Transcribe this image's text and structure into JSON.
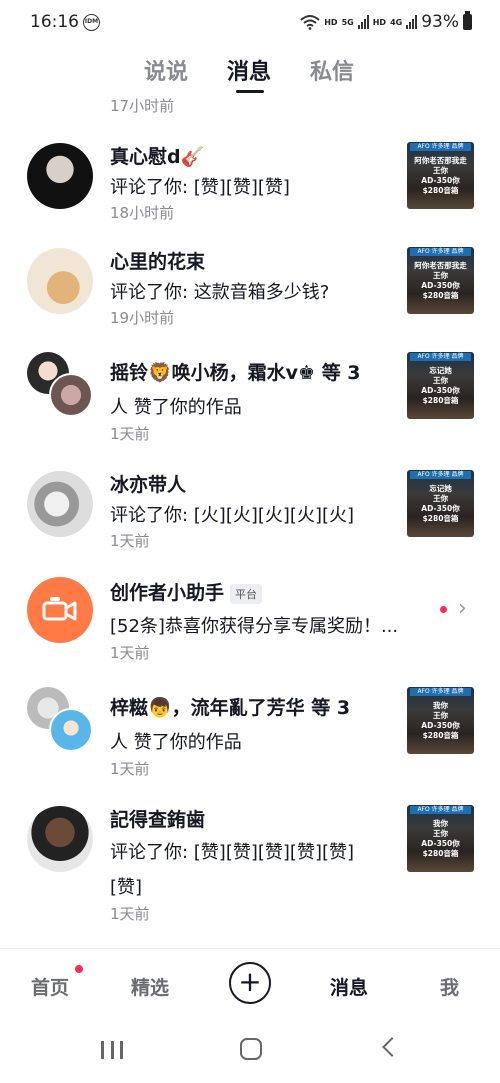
{
  "status_bar": {
    "time": "16:16",
    "idm_badge": "IDM",
    "wifi_hd": "HD",
    "net_5g": "5G",
    "hd2": "HD",
    "net_4g": "4G",
    "battery": "93%"
  },
  "top_tabs": [
    {
      "label": "说说",
      "active": false
    },
    {
      "label": "消息",
      "active": true
    },
    {
      "label": "私信",
      "active": false
    }
  ],
  "scroll_top_time": "17小时前",
  "thumb_text": {
    "banner": "AFO 许多理 品牌",
    "line_a": "阿你老否那我走",
    "line_b": "忘记她",
    "line_c": "我你",
    "model": "AD-350你",
    "price": "$280音箱",
    "brand": "王你"
  },
  "messages": [
    {
      "name": "真心慰d🎸",
      "text": "评论了你: [赞][赞][赞]",
      "time": "18小时前"
    },
    {
      "name": "心里的花束",
      "text": "评论了你: 这款音箱多少钱?",
      "time": "19小时前"
    },
    {
      "name": "摇铃🦁唤小杨，霜水v♚ 等 3",
      "text": "人 赞了你的作品",
      "time": "1天前"
    },
    {
      "name": "冰亦带人",
      "text": "评论了你: [火][火][火][火][火]",
      "time": "1天前"
    },
    {
      "name": "创作者小助手",
      "badge": "平台",
      "text": "[52条]恭喜你获得分享专属奖励！...",
      "time": "1天前"
    },
    {
      "name": "梓糍👦，流年亂了芳华 等 3",
      "text": "人 赞了你的作品",
      "time": "1天前"
    },
    {
      "name": "記得查銪歯",
      "text": "评论了你: [赞][赞][赞][赞][赞]",
      "text2": "[赞]",
      "time": "1天前"
    }
  ],
  "bottom_nav": {
    "home": "首页",
    "featured": "精选",
    "plus": "+",
    "messages": "消息",
    "me": "我"
  },
  "colors": {
    "accent_red": "#fe2c55",
    "assistant_orange": "#ff7a45",
    "text_primary": "#161823",
    "text_secondary": "#8a8b91"
  }
}
